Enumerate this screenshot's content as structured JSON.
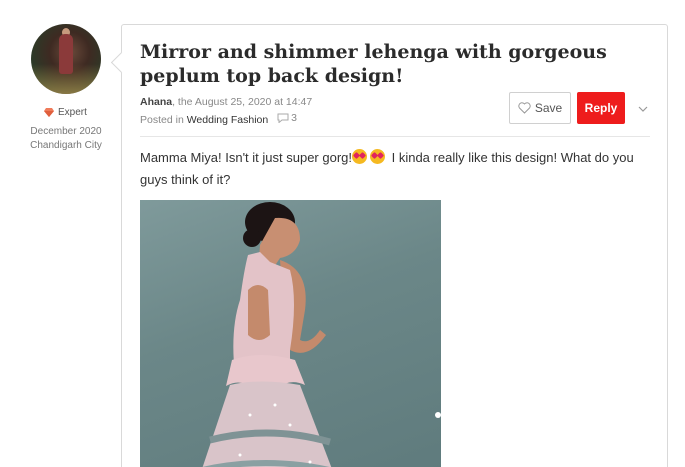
{
  "author": {
    "badge": "Expert",
    "member_since": "December 2020",
    "location": "Chandigarh City"
  },
  "post": {
    "title": "Mirror and shimmer lehenga with gorgeous peplum top back design!",
    "author_name": "Ahana",
    "date_text": ", the August 25, 2020 at 14:47",
    "posted_in_prefix": "Posted in",
    "category": "Wedding Fashion",
    "comment_count": "3",
    "body_part1": "Mamma Miya! Isn't it just super gorg!",
    "body_part2": " I kinda really like this design! What do you guys think of it?"
  },
  "actions": {
    "save_label": "Save",
    "reply_label": "Reply"
  },
  "icons": {
    "badge": "diamond-icon",
    "comment": "speech-bubble-icon",
    "save": "heart-icon",
    "more": "chevron-down-icon",
    "emoji": "heart-eyes-emoji-icon"
  },
  "colors": {
    "reply_button": "#ee1c1c",
    "badge_diamond": "#ef7b5a"
  }
}
